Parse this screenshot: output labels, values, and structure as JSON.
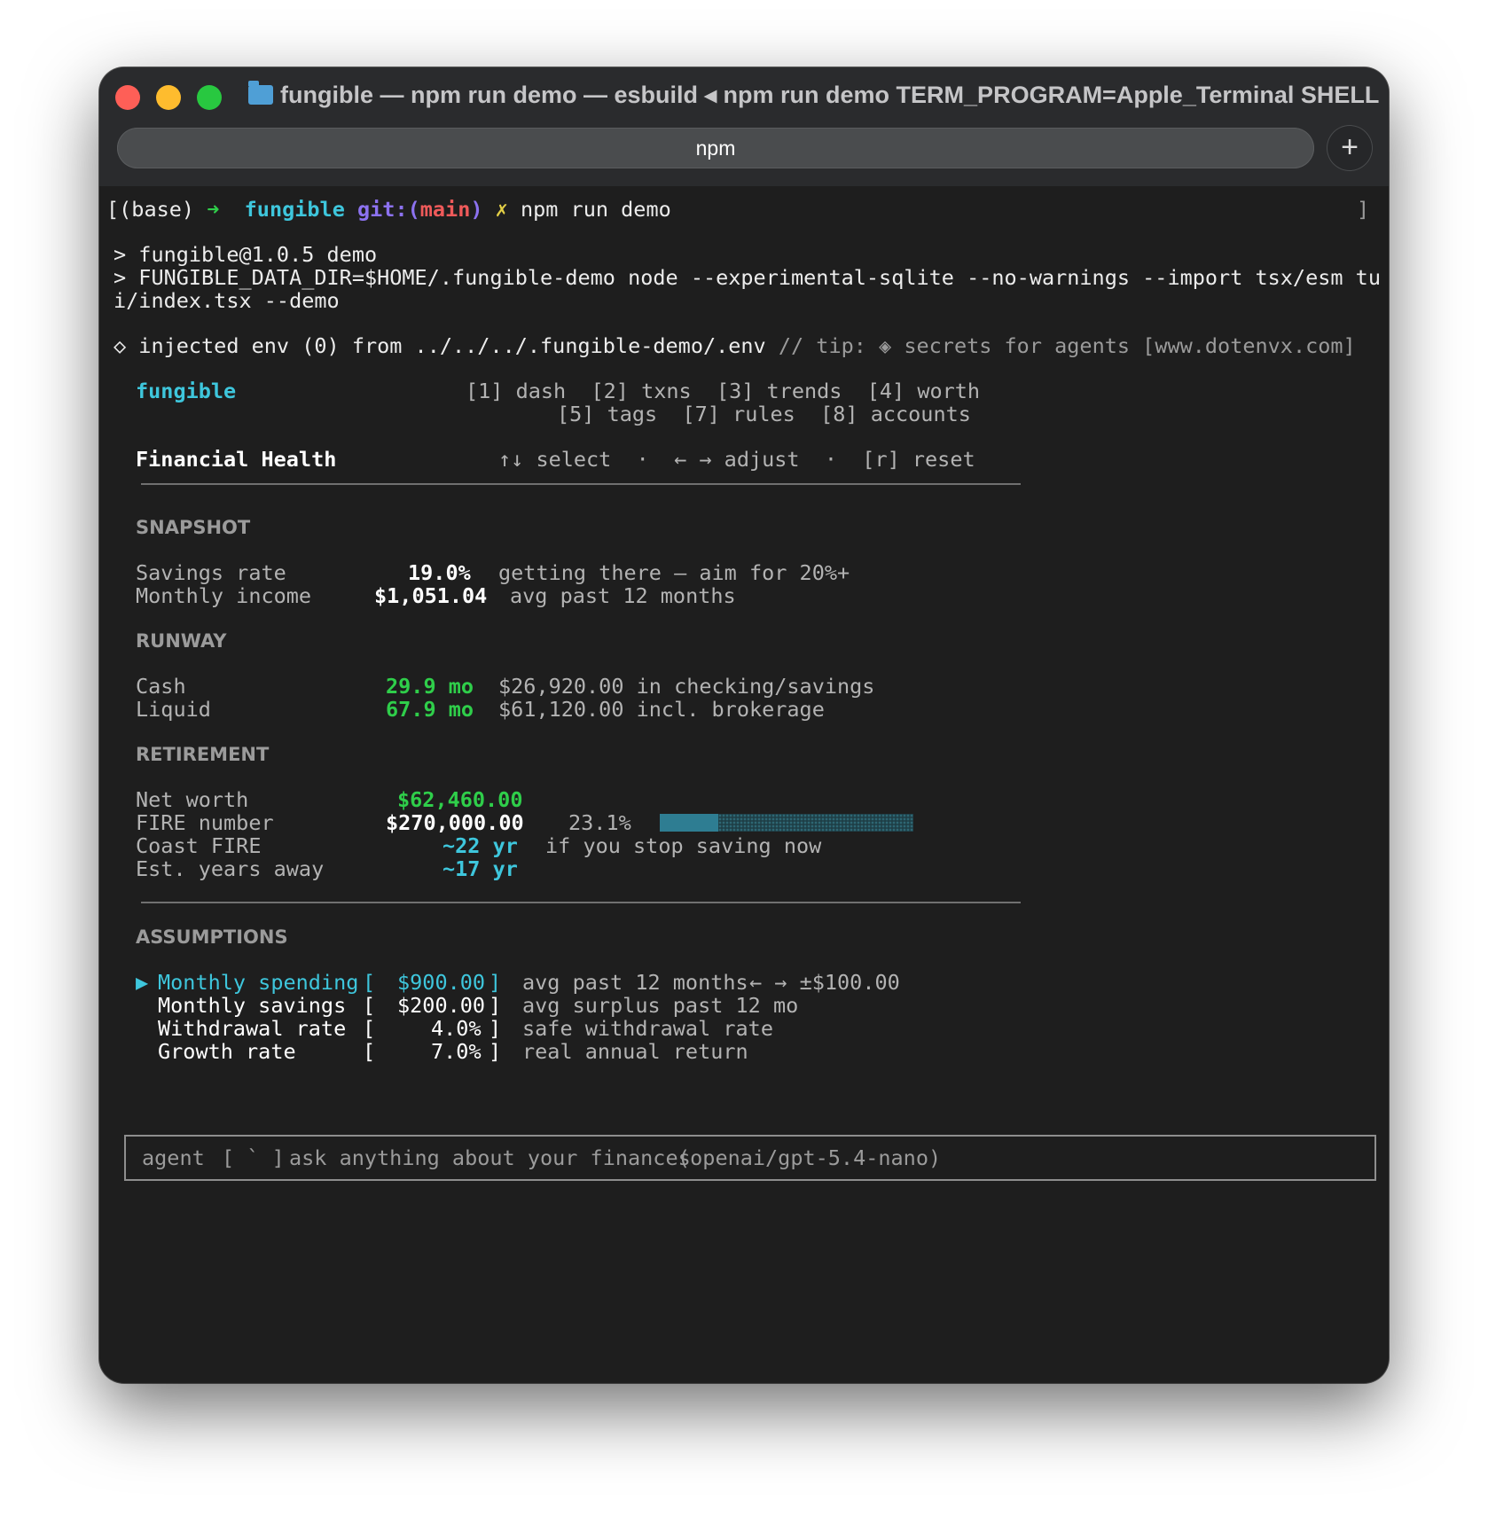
{
  "window": {
    "title": "fungible — npm run demo — esbuild ◂ npm run demo TERM_PROGRAM=Apple_Terminal SHELL=...",
    "tab_label": "npm",
    "new_tab_label": "+"
  },
  "prompt": {
    "prefix": "[(base)",
    "arrow": "➜",
    "dir": "fungible",
    "git_prefix": "git:(",
    "branch": "main",
    "git_suffix": ")",
    "dirty_mark": "✗",
    "command": "npm run demo",
    "right_bracket": "]"
  },
  "output": {
    "line1": "> fungible@1.0.5 demo",
    "line2": "> FUNGIBLE_DATA_DIR=$HOME/.fungible-demo node --experimental-sqlite --no-warnings --import tsx/esm tu",
    "line3": "i/index.tsx --demo",
    "env_main": "◇ injected env (0) from ../../../.fungible-demo/.env",
    "env_tip": " // tip: ◈ secrets for agents [www.dotenvx.com]"
  },
  "app": {
    "brand": "fungible",
    "nav_row1": "[1] dash  [2] txns  [3] trends  [4] worth",
    "nav_row2": "[5] tags  [7] rules  [8] accounts",
    "view_title": "Financial Health",
    "keys_hint": "↑↓ select  ·  ← → adjust  ·  [r] reset"
  },
  "snapshot": {
    "heading": "SNAPSHOT",
    "rows": [
      {
        "label": "Savings rate",
        "value": "19.0%",
        "note": "getting there — aim for 20%+"
      },
      {
        "label": "Monthly income",
        "value": "$1,051.04",
        "note": "avg past 12 months"
      }
    ]
  },
  "runway": {
    "heading": "RUNWAY",
    "rows": [
      {
        "label": "Cash",
        "value": "29.9 mo",
        "note": "$26,920.00 in checking/savings"
      },
      {
        "label": "Liquid",
        "value": "67.9 mo",
        "note": "$61,120.00 incl. brokerage"
      }
    ]
  },
  "retirement": {
    "heading": "RETIREMENT",
    "net_worth_label": "Net worth",
    "net_worth": "$62,460.00",
    "fire_label": "FIRE number",
    "fire_value": "$270,000.00",
    "fire_pct": "23.1%",
    "fire_progress": 0.231,
    "coast_label": "Coast FIRE",
    "coast_value": "~22 yr",
    "coast_note": "if you stop saving now",
    "years_label": "Est. years away",
    "years_value": "~17 yr"
  },
  "assumptions": {
    "heading": "ASSUMPTIONS",
    "selected_marker": "▶",
    "rows": [
      {
        "label": "Monthly spending",
        "value": "$900.00",
        "note": "avg past 12 months",
        "adjust": "← → ±$100.00"
      },
      {
        "label": "Monthly savings",
        "value": "$200.00",
        "note": "avg surplus past 12 mo"
      },
      {
        "label": "Withdrawal rate",
        "value": "4.0%",
        "note": "safe withdrawal rate"
      },
      {
        "label": "Growth rate",
        "value": "7.0%",
        "note": "real annual return"
      }
    ]
  },
  "agent": {
    "label": "agent",
    "key": "[ ` ]",
    "placeholder": "ask anything about your finances",
    "model": "(openai/gpt-5.4-nano)"
  },
  "colors": {
    "accent_cyan": "#3ec6dc",
    "positive_green": "#2fce4a",
    "bar_fill": "#2e7d92",
    "terminal_bg": "#1e1e1e"
  }
}
